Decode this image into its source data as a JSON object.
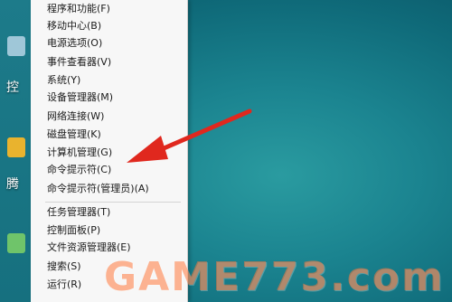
{
  "desktop": {
    "icon_labels": [
      "控",
      "腾"
    ]
  },
  "context_menu": {
    "items": [
      "程序和功能(F)",
      "移动中心(B)",
      "电源选项(O)",
      "事件查看器(V)",
      "系统(Y)",
      "设备管理器(M)",
      "网络连接(W)",
      "磁盘管理(K)",
      "计算机管理(G)",
      "命令提示符(C)",
      "命令提示符(管理员)(A)",
      "任务管理器(T)",
      "控制面板(P)",
      "文件资源管理器(E)",
      "搜索(S)",
      "运行(R)"
    ]
  },
  "annotation": {
    "arrow_color": "#e0281e"
  },
  "watermark": {
    "text": "GAME773.com"
  }
}
